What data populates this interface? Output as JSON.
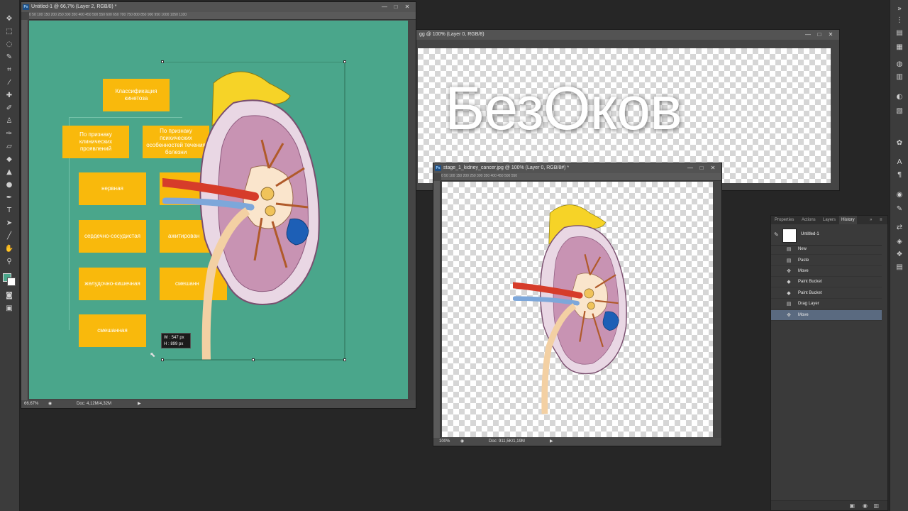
{
  "main_doc": {
    "title": "Untitled-1 @ 66,7% (Layer 2, RGB/8) *",
    "ruler_ticks": "0      50      100      150      200      250      300      350      400      450      500      550      600      650      700      750      800      850      900      950      1000      1050      1100",
    "zoom": "66.67%",
    "doc_size": "Doc: 4,12M/4,32M",
    "canvas_color": "#4aa68b",
    "transform_w": "W : 547 px",
    "transform_h": "H : 899 px",
    "flowchart": {
      "root": "Классификация кинетоза",
      "branch_left": "По признаку клинических проявлений",
      "branch_right": "По признаку психических особенностей течения болезни",
      "left_items": [
        "нервная",
        "сердечно-сосудистая",
        "желудочно-кишечная",
        "смешанная"
      ],
      "right_items": [
        "",
        "ажитирован",
        "смешанн"
      ]
    }
  },
  "text_doc": {
    "title": "gg @ 100% (Layer 0, RGB/8)",
    "watermark": "БезОков"
  },
  "kidney_doc": {
    "title": "stage_1_kidney_cancer.jpg @ 100% (Layer 0, RGB/8#) *",
    "ruler_ticks": "0     50     100     150     200     250     300     350     400     450     500     550",
    "zoom": "100%",
    "doc_size": "Doc: 911,5K/1,19M"
  },
  "history_panel": {
    "tabs": [
      "Properties",
      "Actions",
      "Layers",
      "History"
    ],
    "active_tab": "History",
    "snapshot": "Untitled-1",
    "steps": [
      {
        "label": "New",
        "icon": "document-icon"
      },
      {
        "label": "Paste",
        "icon": "document-icon"
      },
      {
        "label": "Move",
        "icon": "move-icon"
      },
      {
        "label": "Paint Bucket",
        "icon": "paint-bucket-icon"
      },
      {
        "label": "Paint Bucket",
        "icon": "paint-bucket-icon"
      },
      {
        "label": "Drag Layer",
        "icon": "document-icon"
      },
      {
        "label": "Move",
        "icon": "move-icon"
      }
    ],
    "selected_step": "Move"
  },
  "colors": {
    "accent_box": "#f9b90c",
    "canvas_green": "#4aa68b",
    "history_selected": "#5a6a80"
  }
}
